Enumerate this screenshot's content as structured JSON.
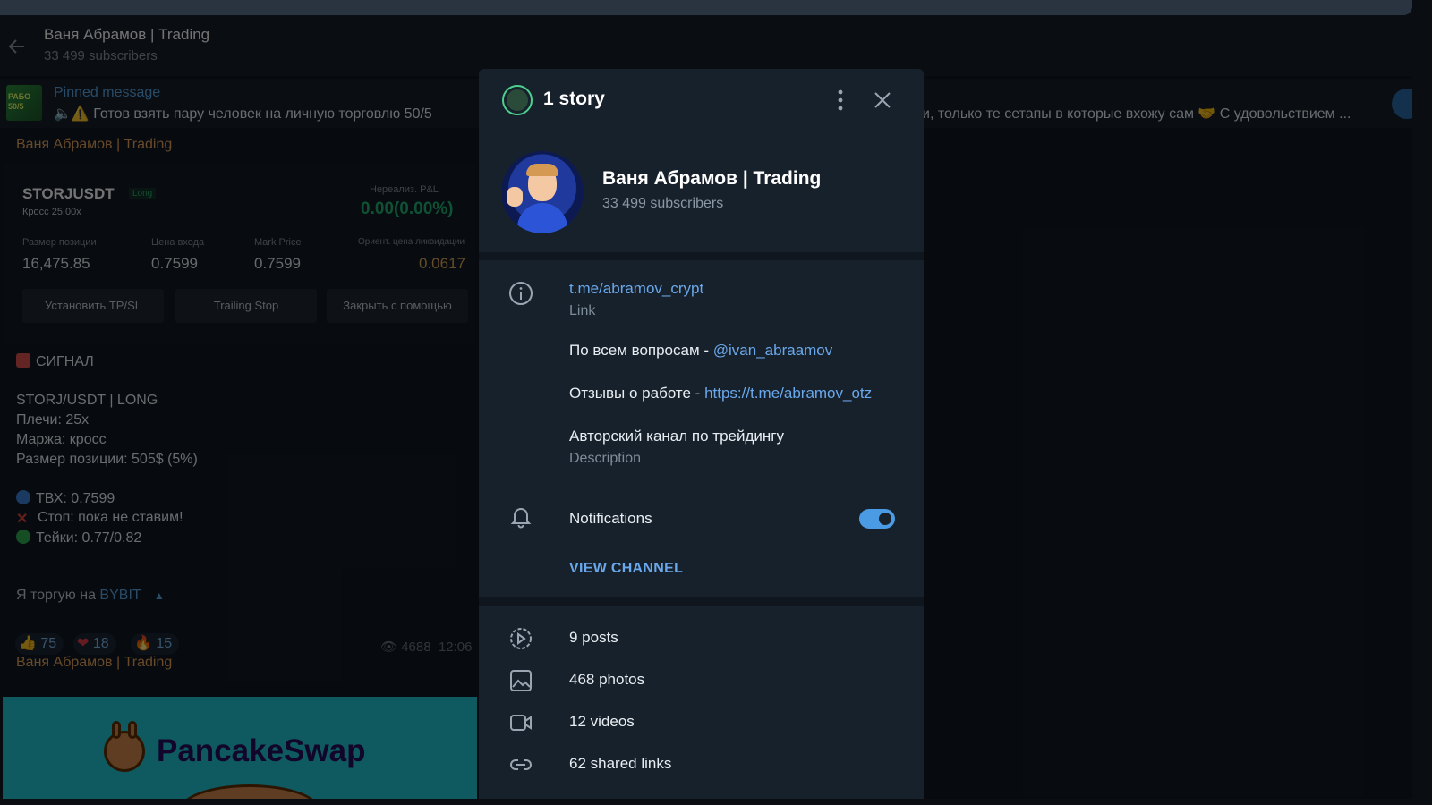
{
  "header": {
    "title": "Ваня Абрамов | Trading",
    "subscribers": "33 499 subscribers"
  },
  "pinned": {
    "label": "Pinned message",
    "thumb_text": "РАБО 50/5",
    "text_left": "🔈⚠️ Готов взять пару человек на личную торговлю 50/5",
    "text_right": "и, только те сетапы в которые вхожу сам 🤝 С удовольствием ..."
  },
  "messages": {
    "sender1": "Ваня Абрамов | Trading",
    "card": {
      "symbol": "STORJUSDT",
      "side": "Long",
      "cross": "Кросс 25.00x",
      "pnl_label": "Нереализ. P&L",
      "pnl": "0.00(0.00%)",
      "cols": [
        {
          "label": "Размер позиции",
          "value": "16,475.85"
        },
        {
          "label": "Цена входа",
          "value": "0.7599"
        },
        {
          "label": "Mark Price",
          "value": "0.7599"
        },
        {
          "label": "Ориент. цена ликвидации",
          "value": "0.0617"
        }
      ],
      "buttons": [
        "Установить TP/SL",
        "Trailing Stop",
        "Закрыть с помощью"
      ]
    },
    "signal_title": "СИГНАЛ",
    "lines": [
      "STORJ/USDT | LONG",
      "Плечи: 25x",
      "Маржа: кросс",
      "Размер позиции: 505$ (5%)"
    ],
    "entries": [
      "ТВХ: 0.7599",
      "Стоп: пока не ставим!",
      "Тейки: 0.77/0.82"
    ],
    "trade_on": "Я торгую на",
    "bybit": "BYBIT",
    "reactions": [
      {
        "emoji": "👍",
        "count": "75"
      },
      {
        "emoji": "❤",
        "count": "18"
      },
      {
        "emoji": "🔥",
        "count": "15"
      }
    ],
    "views": "4688",
    "time": "12:06",
    "sender2": "Ваня Абрамов | Trading",
    "pancake_name": "PancakeSwap"
  },
  "modal": {
    "story_title": "1 story",
    "name": "Ваня Абрамов | Trading",
    "subscribers": "33 499 subscribers",
    "link": "t.me/abramov_crypt",
    "link_label": "Link",
    "questions_text": "По всем вопросам - ",
    "questions_link": "@ivan_abraamov",
    "reviews_text": "Отзывы о работе - ",
    "reviews_link": "https://t.me/abramov_otz",
    "description": "Авторский канал по трейдингу",
    "description_label": "Description",
    "notifications": "Notifications",
    "notifications_on": true,
    "view_channel": "VIEW CHANNEL",
    "media": [
      {
        "icon": "posts-icon",
        "label": "9 posts"
      },
      {
        "icon": "photos-icon",
        "label": "468 photos"
      },
      {
        "icon": "videos-icon",
        "label": "12 videos"
      },
      {
        "icon": "links-icon",
        "label": "62 shared links"
      }
    ]
  },
  "colors": {
    "accent": "#6aa8ec",
    "sender": "#e6a35c",
    "pnl_green": "#1fb373"
  }
}
